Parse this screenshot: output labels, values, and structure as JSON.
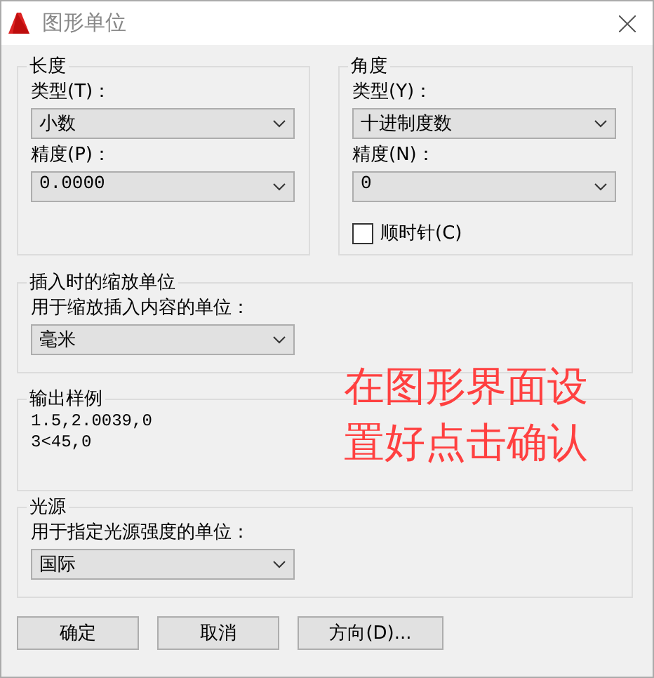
{
  "window": {
    "title": "图形单位"
  },
  "length": {
    "title": "长度",
    "type_label": "类型(T)：",
    "type_value": "小数",
    "precision_label": "精度(P)：",
    "precision_value": "0.0000"
  },
  "angle": {
    "title": "角度",
    "type_label": "类型(Y)：",
    "type_value": "十进制度数",
    "precision_label": "精度(N)：",
    "precision_value": "0",
    "clockwise": {
      "label": "顺时针(C)",
      "checked": false
    }
  },
  "insert_scale": {
    "title": "插入时的缩放单位",
    "label": "用于缩放插入内容的单位：",
    "value": "毫米"
  },
  "sample_output": {
    "title": "输出样例",
    "lines": [
      "1.5,2.0039,0",
      "3<45,0"
    ]
  },
  "lighting": {
    "title": "光源",
    "label": "用于指定光源强度的单位：",
    "value": "国际"
  },
  "buttons": [
    "确定",
    "取消",
    "方向(D)..."
  ],
  "annotation": {
    "lines": [
      "在图形界面设",
      "置好点击确认"
    ]
  }
}
